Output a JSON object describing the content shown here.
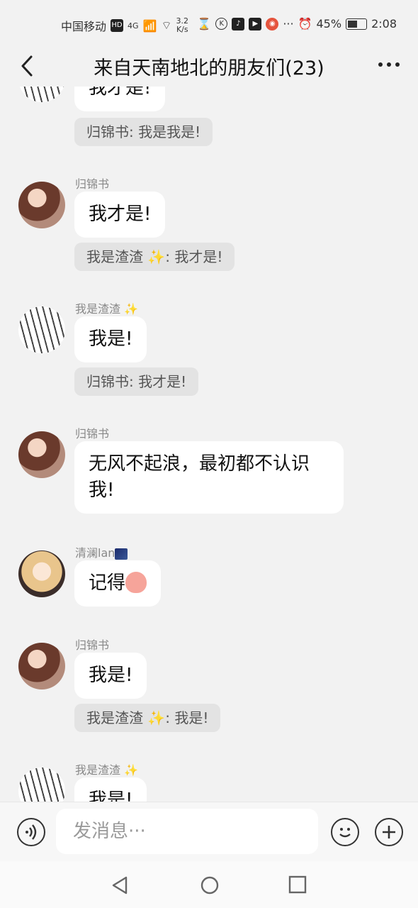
{
  "status_bar": {
    "carrier": "中国移动",
    "hd": "HD",
    "network": "4G",
    "speed_value": "3.2",
    "speed_unit": "K/s",
    "battery_percent": "45%",
    "battery_level": 0.45,
    "time": "2:08"
  },
  "header": {
    "title": "来自天南地北的朋友们(23)"
  },
  "messages": {
    "m0": {
      "text": "我才是!"
    },
    "q0": {
      "text": "归锦书: 我是我是!"
    },
    "m1": {
      "sender": "归锦书",
      "text": "我才是!"
    },
    "q1": {
      "text": "我是渣渣 ✨: 我才是!"
    },
    "m2": {
      "sender": "我是渣渣",
      "sender_emoji": "✨",
      "text": "我是!"
    },
    "q2": {
      "text": "归锦书: 我才是!"
    },
    "m3": {
      "sender": "归锦书",
      "text": "无风不起浪，最初都不认识我!"
    },
    "m4": {
      "sender": "清澜lan",
      "text": "记得"
    },
    "m5": {
      "sender": "归锦书",
      "text": "我是!"
    },
    "q5": {
      "text": "我是渣渣 ✨: 我是!"
    },
    "m6": {
      "sender": "我是渣渣",
      "sender_emoji": "✨",
      "text": "我是!"
    }
  },
  "input": {
    "placeholder": "发消息···"
  },
  "colors": {
    "background": "#f2f2f2",
    "bubble": "#ffffff",
    "quote": "#e3e3e3",
    "sender": "#888888"
  }
}
